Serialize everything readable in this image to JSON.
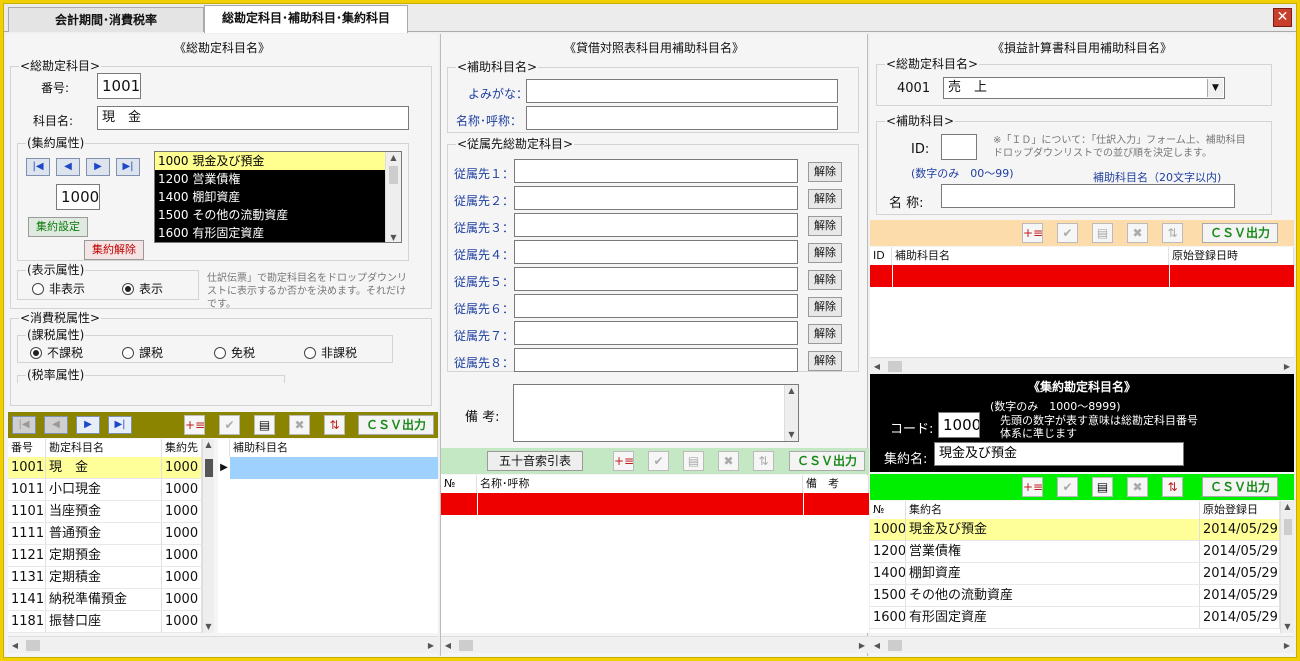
{
  "tabs": [
    {
      "label": "会計期間･消費税率"
    },
    {
      "label": "総勘定科目･補助科目･集約科目"
    }
  ],
  "left": {
    "title": "《総勘定科目名》",
    "group_account": "<総勘定科目>",
    "number_label": "番号:",
    "number_value": "1001",
    "name_label": "科目名:",
    "name_value": "現　金",
    "group_summary": "(集約属性)",
    "summary_code": "1000",
    "summary_set_btn": "集約設定",
    "summary_release_btn": "集約解除",
    "summary_list": [
      {
        "text": "1000 現金及び預金"
      },
      {
        "text": "1200 営業債権"
      },
      {
        "text": "1400 棚卸資産"
      },
      {
        "text": "1500 その他の流動資産"
      },
      {
        "text": "1600 有形固定資産"
      }
    ],
    "group_display": "(表示属性)",
    "radio_hide": "非表示",
    "radio_show": "表示",
    "display_note": "仕訳伝票」で勘定科目名をドロップダウンリストに表示するか否かを決めます。それだけです。",
    "group_tax": "<消費税属性>",
    "group_taxable": "(課税属性)",
    "tax_options": [
      "不課税",
      "課税",
      "免税",
      "非課税"
    ],
    "group_rate": "(税率属性)",
    "csv_label": "ＣＳＶ出力",
    "grid_headers": [
      "番号",
      "勘定科目名",
      "集約先"
    ],
    "sub_header": "補助科目名",
    "grid_rows": [
      {
        "code": "1001",
        "name": "現　金",
        "agg": "1000"
      },
      {
        "code": "1011",
        "name": "小口現金",
        "agg": "1000"
      },
      {
        "code": "1101",
        "name": "当座預金",
        "agg": "1000"
      },
      {
        "code": "1111",
        "name": "普通預金",
        "agg": "1000"
      },
      {
        "code": "1121",
        "name": "定期預金",
        "agg": "1000"
      },
      {
        "code": "1131",
        "name": "定期積金",
        "agg": "1000"
      },
      {
        "code": "1141",
        "name": "納税準備預金",
        "agg": "1000"
      },
      {
        "code": "1181",
        "name": "振替口座",
        "agg": "1000"
      }
    ]
  },
  "mid": {
    "title": "《貸借対照表科目用補助科目名》",
    "group_sub": "<補助科目名>",
    "reading_label": "よみがな：",
    "name_label": "名称･呼称：",
    "group_parent": "<従属先総勘定科目>",
    "parents": [
      {
        "label": "従属先１：",
        "btn": "解除"
      },
      {
        "label": "従属先２：",
        "btn": "解除"
      },
      {
        "label": "従属先３：",
        "btn": "解除"
      },
      {
        "label": "従属先４：",
        "btn": "解除"
      },
      {
        "label": "従属先５：",
        "btn": "解除"
      },
      {
        "label": "従属先６：",
        "btn": "解除"
      },
      {
        "label": "従属先７：",
        "btn": "解除"
      },
      {
        "label": "従属先８：",
        "btn": "解除"
      }
    ],
    "memo_label": "備 考:",
    "index_btn": "五十音索引表",
    "csv_label": "ＣＳＶ出力",
    "grid_headers": [
      "№",
      "名称･呼称",
      "備　考"
    ]
  },
  "right": {
    "title": "《損益計算書科目用補助科目名》",
    "group_account": "<総勘定科目名>",
    "account_code": "4001",
    "account_name": "売　上",
    "group_sub": "<補助科目>",
    "id_label": "ID:",
    "id_note": "※「ＩＤ」について：「仕訳入力」フォーム上、補助科目ドロップダウンリストでの並び順を決定します。",
    "digits_note": "(数字のみ　00～99)",
    "subname_note": "補助科目名（20文字以内)",
    "name_label": "名 称:",
    "csv_label": "ＣＳＶ出力",
    "grid_headers": [
      "ID",
      "補助科目名",
      "原始登録日時"
    ],
    "summary_title": "《集約勘定科目名》",
    "summary_digits": "(数字のみ　1000～8999)",
    "code_label": "コード:",
    "code_value": "1000",
    "code_note": "先頭の数字が表す意味は総勘定科目番号体系に準じます",
    "sname_label": "集約名:",
    "sname_value": "現金及び預金",
    "csv2_label": "ＣＳＶ出力",
    "grid2_headers": [
      "№",
      "集約名",
      "原始登録日"
    ],
    "grid2_rows": [
      {
        "code": "1000",
        "name": "現金及び預金",
        "date": "2014/05/29"
      },
      {
        "code": "1200",
        "name": "営業債権",
        "date": "2014/05/29"
      },
      {
        "code": "1400",
        "name": "棚卸資産",
        "date": "2014/05/29"
      },
      {
        "code": "1500",
        "name": "その他の流動資産",
        "date": "2014/05/29"
      },
      {
        "code": "1600",
        "name": "有形固定資産",
        "date": "2014/05/29"
      }
    ]
  },
  "colors": {
    "accent_yellow": "#f0d000",
    "olive": "#8a8400",
    "peach": "#fbdcaa",
    "mint": "#c4e8c4",
    "green": "#00ee00",
    "red": "#ee0000",
    "select_yellow": "#ffff99"
  }
}
